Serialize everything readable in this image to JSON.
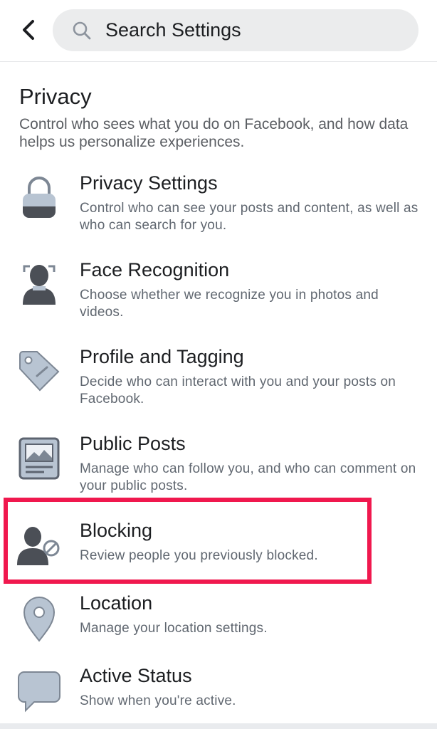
{
  "header": {
    "back_icon": "chevron-left-icon",
    "search_icon": "search-icon",
    "search_placeholder": "Search Settings"
  },
  "section": {
    "title": "Privacy",
    "description": "Control who sees what you do on Facebook, and how data helps us personalize experiences."
  },
  "items": [
    {
      "icon": "lock-icon",
      "title": "Privacy Settings",
      "description": "Control who can see your posts and content, as well as who can search for you."
    },
    {
      "icon": "face-recognition-icon",
      "title": "Face Recognition",
      "description": "Choose whether we recognize you in photos and videos."
    },
    {
      "icon": "tag-icon",
      "title": "Profile and Tagging",
      "description": "Decide who can interact with you and your posts on Facebook."
    },
    {
      "icon": "public-post-icon",
      "title": "Public Posts",
      "description": "Manage who can follow you, and who can comment on your public posts."
    },
    {
      "icon": "blocked-user-icon",
      "title": "Blocking",
      "description": "Review people you previously blocked."
    },
    {
      "icon": "location-pin-icon",
      "title": "Location",
      "description": "Manage your location settings."
    },
    {
      "icon": "chat-bubble-icon",
      "title": "Active Status",
      "description": "Show when you're active."
    }
  ],
  "colors": {
    "highlight": "#f0184e",
    "icon_fill": "#b8c4d2",
    "icon_dark": "#4b4f56"
  }
}
